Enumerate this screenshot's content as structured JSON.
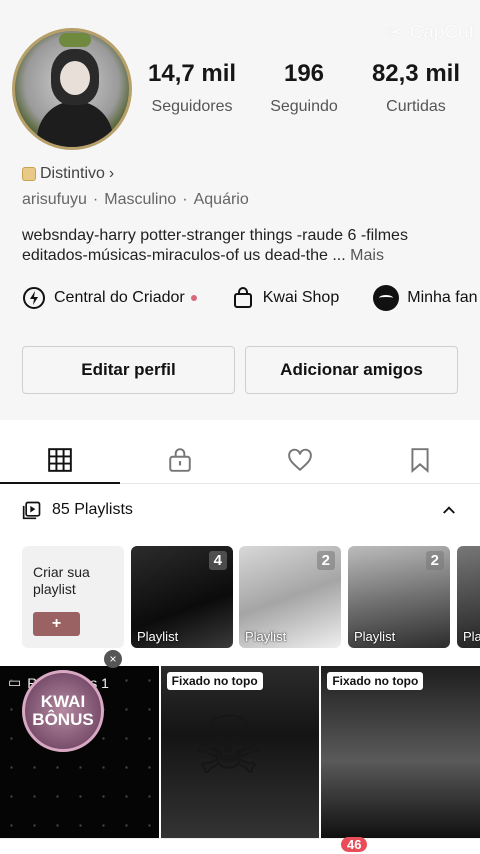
{
  "watermark": {
    "label": "CapCut"
  },
  "profile": {
    "stats": [
      {
        "value": "14,7 mil",
        "label": "Seguidores"
      },
      {
        "value": "196",
        "label": "Seguindo"
      },
      {
        "value": "82,3 mil",
        "label": "Curtidas"
      }
    ],
    "badge_label": "Distintivo",
    "badge_chevron": "›",
    "username": "arisufuyu",
    "gender": "Masculino",
    "sign": "Aquário",
    "separator": "·",
    "bio": "websnday-harry potter-stranger things -raude 6 -filmes editados-músicas-miraculos-of us dead-the ...",
    "bio_more": "Mais"
  },
  "links": [
    {
      "label": "Central do Criador",
      "icon": "bolt-icon"
    },
    {
      "label": "Kwai Shop",
      "icon": "shopping-bag-icon"
    },
    {
      "label": "Minha fan",
      "icon": "fan-logo-icon"
    }
  ],
  "buttons": {
    "edit": "Editar perfil",
    "add_friends": "Adicionar amigos"
  },
  "tabs": [
    {
      "name": "grid",
      "icon": "grid-icon",
      "active": true
    },
    {
      "name": "private",
      "icon": "lock-icon",
      "active": false
    },
    {
      "name": "liked",
      "icon": "heart-icon",
      "active": false
    },
    {
      "name": "saved",
      "icon": "bookmark-icon",
      "active": false
    }
  ],
  "playlists": {
    "header": "85 Playlists",
    "create_label": "Criar sua playlist",
    "create_button": "+",
    "items": [
      {
        "label": "Playlist",
        "count": "4"
      },
      {
        "label": "Playlist",
        "count": "2"
      },
      {
        "label": "Playlist",
        "count": "2"
      },
      {
        "label": "Pla",
        "count": ""
      }
    ]
  },
  "videos": {
    "drafts_label": "Rascunhos 1",
    "kwai_bonus": "KWAI BÔNUS",
    "close": "×",
    "pinned_label": "Fixado no topo"
  },
  "navbar": {
    "notification_count": "46"
  }
}
